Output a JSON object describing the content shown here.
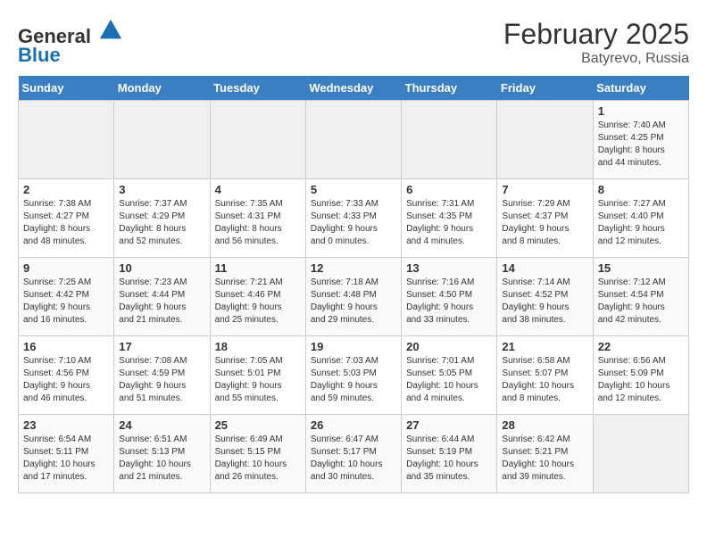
{
  "header": {
    "logo_general": "General",
    "logo_blue": "Blue",
    "month_title": "February 2025",
    "location": "Batyrevo, Russia"
  },
  "days_of_week": [
    "Sunday",
    "Monday",
    "Tuesday",
    "Wednesday",
    "Thursday",
    "Friday",
    "Saturday"
  ],
  "weeks": [
    [
      {
        "day": "",
        "info": ""
      },
      {
        "day": "",
        "info": ""
      },
      {
        "day": "",
        "info": ""
      },
      {
        "day": "",
        "info": ""
      },
      {
        "day": "",
        "info": ""
      },
      {
        "day": "",
        "info": ""
      },
      {
        "day": "1",
        "info": "Sunrise: 7:40 AM\nSunset: 4:25 PM\nDaylight: 8 hours\nand 44 minutes."
      }
    ],
    [
      {
        "day": "2",
        "info": "Sunrise: 7:38 AM\nSunset: 4:27 PM\nDaylight: 8 hours\nand 48 minutes."
      },
      {
        "day": "3",
        "info": "Sunrise: 7:37 AM\nSunset: 4:29 PM\nDaylight: 8 hours\nand 52 minutes."
      },
      {
        "day": "4",
        "info": "Sunrise: 7:35 AM\nSunset: 4:31 PM\nDaylight: 8 hours\nand 56 minutes."
      },
      {
        "day": "5",
        "info": "Sunrise: 7:33 AM\nSunset: 4:33 PM\nDaylight: 9 hours\nand 0 minutes."
      },
      {
        "day": "6",
        "info": "Sunrise: 7:31 AM\nSunset: 4:35 PM\nDaylight: 9 hours\nand 4 minutes."
      },
      {
        "day": "7",
        "info": "Sunrise: 7:29 AM\nSunset: 4:37 PM\nDaylight: 9 hours\nand 8 minutes."
      },
      {
        "day": "8",
        "info": "Sunrise: 7:27 AM\nSunset: 4:40 PM\nDaylight: 9 hours\nand 12 minutes."
      }
    ],
    [
      {
        "day": "9",
        "info": "Sunrise: 7:25 AM\nSunset: 4:42 PM\nDaylight: 9 hours\nand 16 minutes."
      },
      {
        "day": "10",
        "info": "Sunrise: 7:23 AM\nSunset: 4:44 PM\nDaylight: 9 hours\nand 21 minutes."
      },
      {
        "day": "11",
        "info": "Sunrise: 7:21 AM\nSunset: 4:46 PM\nDaylight: 9 hours\nand 25 minutes."
      },
      {
        "day": "12",
        "info": "Sunrise: 7:18 AM\nSunset: 4:48 PM\nDaylight: 9 hours\nand 29 minutes."
      },
      {
        "day": "13",
        "info": "Sunrise: 7:16 AM\nSunset: 4:50 PM\nDaylight: 9 hours\nand 33 minutes."
      },
      {
        "day": "14",
        "info": "Sunrise: 7:14 AM\nSunset: 4:52 PM\nDaylight: 9 hours\nand 38 minutes."
      },
      {
        "day": "15",
        "info": "Sunrise: 7:12 AM\nSunset: 4:54 PM\nDaylight: 9 hours\nand 42 minutes."
      }
    ],
    [
      {
        "day": "16",
        "info": "Sunrise: 7:10 AM\nSunset: 4:56 PM\nDaylight: 9 hours\nand 46 minutes."
      },
      {
        "day": "17",
        "info": "Sunrise: 7:08 AM\nSunset: 4:59 PM\nDaylight: 9 hours\nand 51 minutes."
      },
      {
        "day": "18",
        "info": "Sunrise: 7:05 AM\nSunset: 5:01 PM\nDaylight: 9 hours\nand 55 minutes."
      },
      {
        "day": "19",
        "info": "Sunrise: 7:03 AM\nSunset: 5:03 PM\nDaylight: 9 hours\nand 59 minutes."
      },
      {
        "day": "20",
        "info": "Sunrise: 7:01 AM\nSunset: 5:05 PM\nDaylight: 10 hours\nand 4 minutes."
      },
      {
        "day": "21",
        "info": "Sunrise: 6:58 AM\nSunset: 5:07 PM\nDaylight: 10 hours\nand 8 minutes."
      },
      {
        "day": "22",
        "info": "Sunrise: 6:56 AM\nSunset: 5:09 PM\nDaylight: 10 hours\nand 12 minutes."
      }
    ],
    [
      {
        "day": "23",
        "info": "Sunrise: 6:54 AM\nSunset: 5:11 PM\nDaylight: 10 hours\nand 17 minutes."
      },
      {
        "day": "24",
        "info": "Sunrise: 6:51 AM\nSunset: 5:13 PM\nDaylight: 10 hours\nand 21 minutes."
      },
      {
        "day": "25",
        "info": "Sunrise: 6:49 AM\nSunset: 5:15 PM\nDaylight: 10 hours\nand 26 minutes."
      },
      {
        "day": "26",
        "info": "Sunrise: 6:47 AM\nSunset: 5:17 PM\nDaylight: 10 hours\nand 30 minutes."
      },
      {
        "day": "27",
        "info": "Sunrise: 6:44 AM\nSunset: 5:19 PM\nDaylight: 10 hours\nand 35 minutes."
      },
      {
        "day": "28",
        "info": "Sunrise: 6:42 AM\nSunset: 5:21 PM\nDaylight: 10 hours\nand 39 minutes."
      },
      {
        "day": "",
        "info": ""
      }
    ]
  ]
}
